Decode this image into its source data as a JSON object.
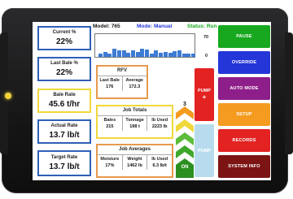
{
  "left_panel": {
    "current_pct": {
      "label": "Current %",
      "value": "22%"
    },
    "last_bale_pct": {
      "label": "Last Bale %",
      "value": "22%"
    },
    "bale_rate": {
      "label": "Bale Rate",
      "value": "45.6 t/hr"
    },
    "actual_rate": {
      "label": "Actual Rate",
      "value": "13.7 lb/t"
    },
    "target_rate": {
      "label": "Target Rate",
      "value": "13.7 lb/t"
    }
  },
  "header": {
    "model": "Model: 765",
    "mode": "Mode: Manual",
    "status": "Status: Run"
  },
  "moisture_history": {
    "scale_max": "70",
    "scale_min": "0",
    "values": [
      9,
      14,
      11,
      26,
      21,
      19,
      13,
      20,
      16,
      24,
      23,
      11,
      21,
      12,
      15,
      13,
      17,
      20,
      10,
      11,
      9
    ]
  },
  "rfv": {
    "title": "RFV",
    "columns": [
      {
        "header": "Last Bale",
        "value": "176"
      },
      {
        "header": "Average",
        "value": "172.3"
      }
    ]
  },
  "job_totals": {
    "title": "Job Totals",
    "columns": [
      {
        "header": "Bales",
        "value": "215"
      },
      {
        "header": "Tonnage",
        "value": "198 t"
      },
      {
        "header": "lb Used",
        "value": "2223 lb"
      }
    ]
  },
  "job_averages": {
    "title": "Job Averages",
    "columns": [
      {
        "header": "Moisture",
        "value": "17%"
      },
      {
        "header": "Weight",
        "value": "1462 lb"
      },
      {
        "header": "lb Used",
        "value": "6.3 lb/t"
      }
    ]
  },
  "pump": {
    "up_label": "PUMP",
    "up_sign": "+",
    "down_label": "PUMP",
    "speed_level": "3",
    "on_label": "ON"
  },
  "buttons": {
    "pause": "PAUSE",
    "override": "OVERRIDE",
    "auto_mode": "AUTO MODE",
    "setup": "SETUP",
    "records": "RECORDS",
    "system_info": "SYSTEM INFO"
  },
  "colors": {
    "pause": "#17a81f",
    "override": "#2536d8",
    "auto_mode": "#8e1e8a",
    "setup": "#f49b20",
    "records": "#e32222",
    "system_info": "#7c1414"
  }
}
